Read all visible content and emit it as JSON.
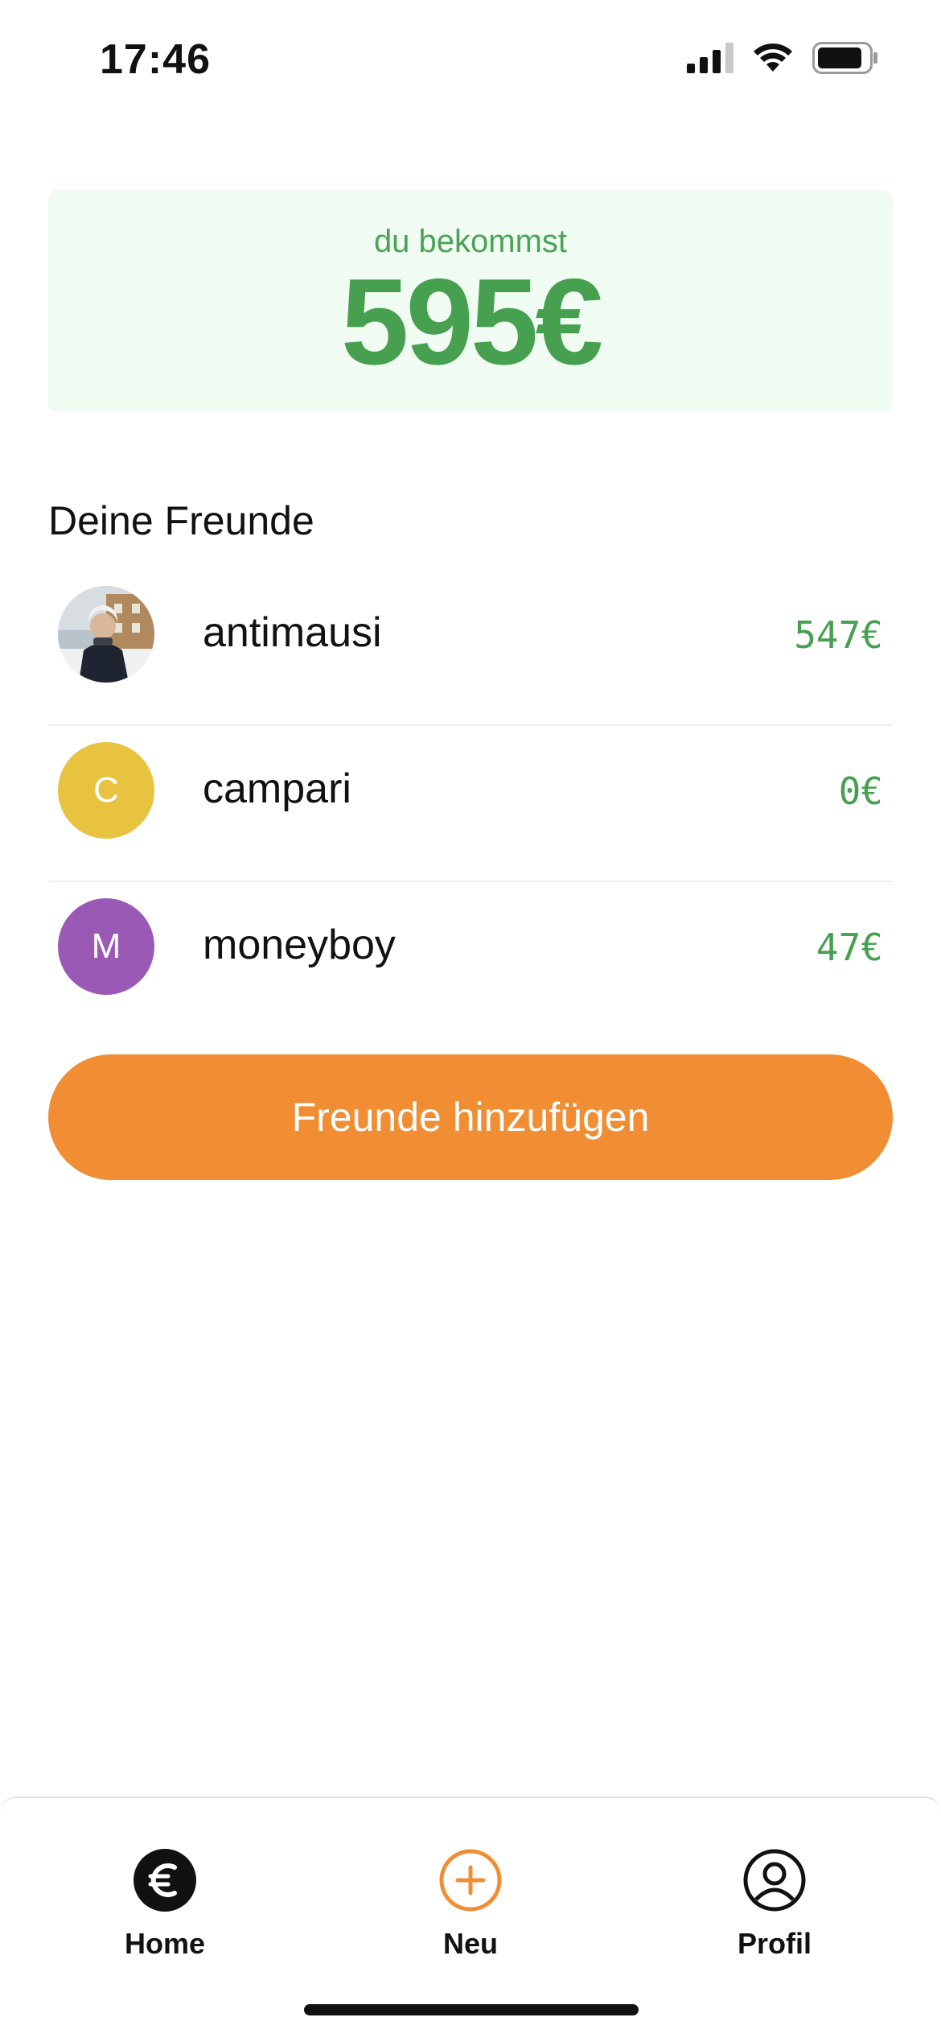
{
  "status_bar": {
    "time": "17:46",
    "icons": [
      "cellular-signal-icon",
      "wifi-icon",
      "battery-icon"
    ]
  },
  "balance": {
    "label": "du bekommst",
    "amount": "595€"
  },
  "friends": {
    "title": "Deine Freunde",
    "items": [
      {
        "name": "antimausi",
        "amount": "547€",
        "avatar_type": "photo",
        "avatar_letter": ""
      },
      {
        "name": "campari",
        "amount": "0€",
        "avatar_type": "letter",
        "avatar_letter": "C",
        "avatar_color": "#e8c33f"
      },
      {
        "name": "moneyboy",
        "amount": "47€",
        "avatar_type": "letter",
        "avatar_letter": "M",
        "avatar_color": "#9b59b6"
      }
    ]
  },
  "add_button": {
    "label": "Freunde hinzufügen"
  },
  "bottom_nav": {
    "items": [
      {
        "label": "Home",
        "icon": "euro-circle-icon"
      },
      {
        "label": "Neu",
        "icon": "plus-circle-icon"
      },
      {
        "label": "Profil",
        "icon": "user-circle-icon"
      }
    ]
  },
  "colors": {
    "accent_green": "#46a050",
    "card_bg": "#f0fbf2",
    "button_orange": "#f18d33"
  }
}
